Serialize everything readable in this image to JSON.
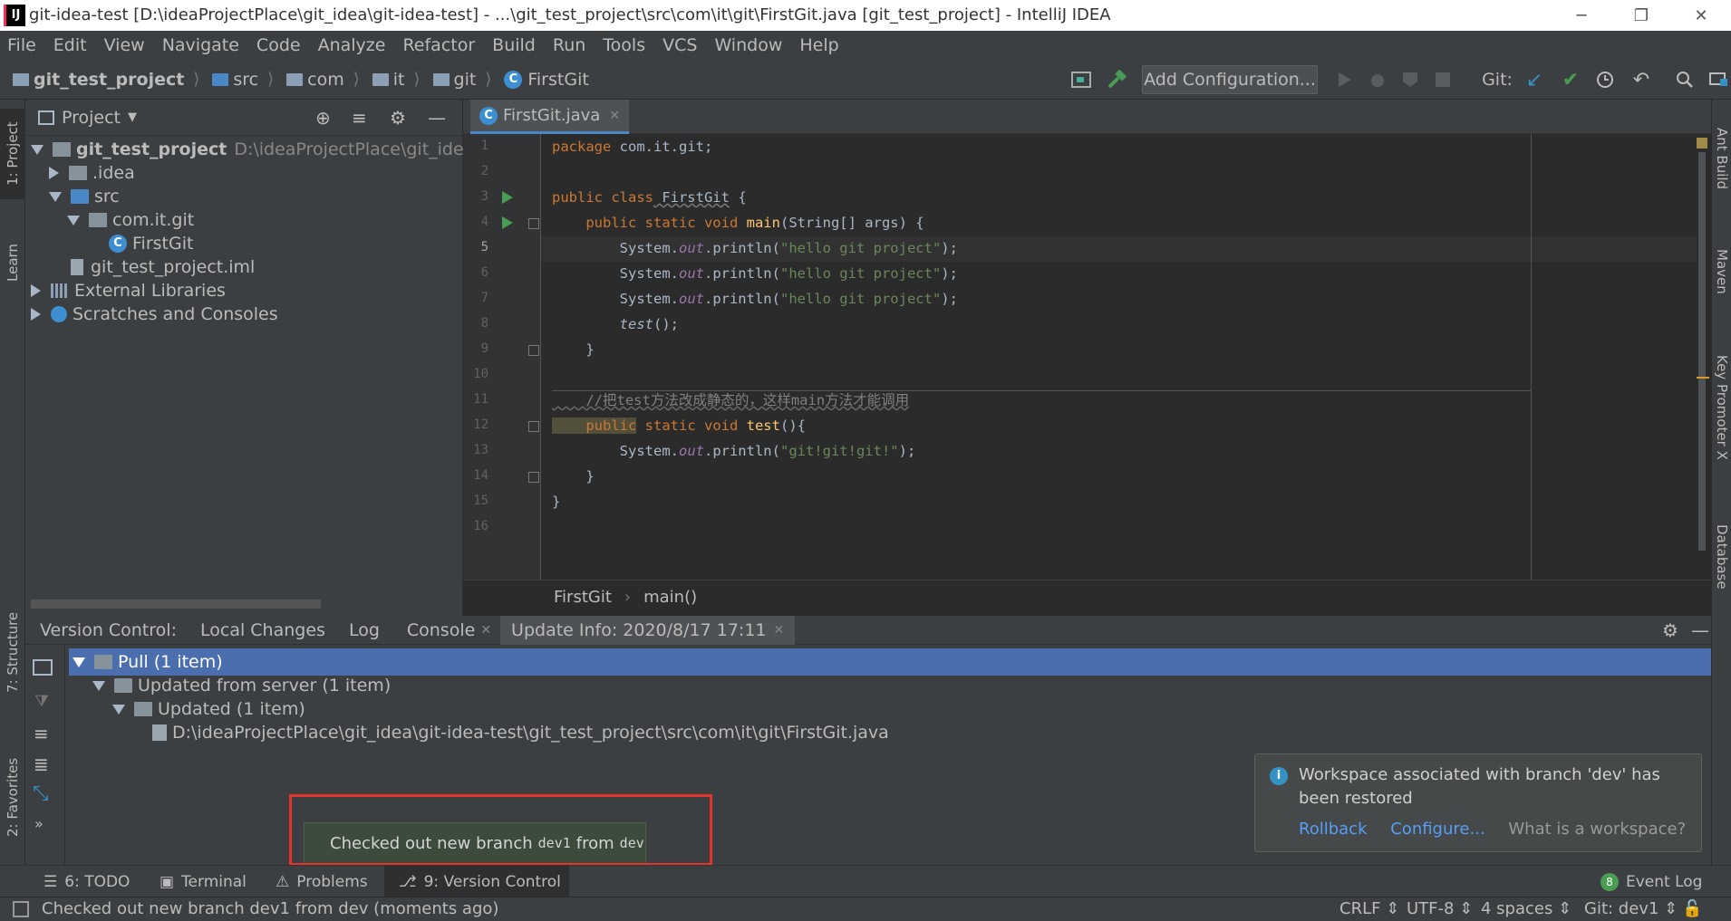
{
  "window": {
    "title": "git-idea-test [D:\\ideaProjectPlace\\git_idea\\git-idea-test] - ...\\git_test_project\\src\\com\\it\\git\\FirstGit.java [git_test_project] - IntelliJ IDEA",
    "app_icon": "IJ"
  },
  "menu": [
    "File",
    "Edit",
    "View",
    "Navigate",
    "Code",
    "Analyze",
    "Refactor",
    "Build",
    "Run",
    "Tools",
    "VCS",
    "Window",
    "Help"
  ],
  "breadcrumbs": [
    "git_test_project",
    "src",
    "com",
    "it",
    "git",
    "FirstGit"
  ],
  "toolbar": {
    "add_configuration": "Add Configuration...",
    "git_label": "Git:"
  },
  "left_stripe": {
    "project": "1: Project",
    "learn": "Learn",
    "structure": "7: Structure",
    "favorites": "2: Favorites"
  },
  "right_stripe": {
    "ant": "Ant Build",
    "maven": "Maven",
    "keypromoter": "Key Promoter X",
    "database": "Database"
  },
  "project_panel": {
    "title": "Project",
    "tree": [
      {
        "label": "git_test_project",
        "extra": "D:\\ideaProjectPlace\\git_idea\\git"
      },
      {
        "label": ".idea"
      },
      {
        "label": "src"
      },
      {
        "label": "com.it.git"
      },
      {
        "label": "FirstGit"
      },
      {
        "label": "git_test_project.iml"
      },
      {
        "label": "External Libraries"
      },
      {
        "label": "Scratches and Consoles"
      }
    ]
  },
  "editor": {
    "tab": "FirstGit.java",
    "line_numbers": [
      "1",
      "2",
      "3",
      "4",
      "5",
      "6",
      "7",
      "8",
      "9",
      "10",
      "11",
      "12",
      "13",
      "14",
      "15",
      "16"
    ],
    "lines": {
      "l1a": "package",
      "l1b": " com.it.git;",
      "l3a": "public class",
      "l3b": " FirstGit",
      "l3c": " {",
      "l4a": "    public static void",
      "l4b": " main",
      "l4c": "(String[] args) {",
      "p_sys": "        System.",
      "p_out": "out",
      "p_println": ".println(",
      "p_str": "\"hello git project\"",
      "p_end": ");",
      "l8a": "        test",
      "l8b": "();",
      "l9": "    }",
      "l11": "    //把test方法改成静态的，这样main方法才能调用",
      "l12a": "    public",
      "l12b": " static void",
      "l12c": " test",
      "l12d": "(){",
      "l13str": "\"git!git!git!\"",
      "l14": "    }",
      "l15": "}"
    },
    "breadcrumb": {
      "class": "FirstGit",
      "method": "main()"
    }
  },
  "version_control": {
    "tabs": [
      "Version Control:",
      "Local Changes",
      "Log",
      "Console",
      "Update Info: 2020/8/17 17:11"
    ],
    "tree": [
      "Pull (1 item)",
      "Updated from server (1 item)",
      "Updated (1 item)",
      "D:\\ideaProjectPlace\\git_idea\\git-idea-test\\git_test_project\\src\\com\\it\\git\\FirstGit.java"
    ]
  },
  "toast": {
    "pre": "Checked out new branch",
    "branch": "dev1",
    "mid": "from",
    "src": "dev"
  },
  "notification": {
    "text": "Workspace associated with branch 'dev' has been restored",
    "rollback": "Rollback",
    "configure": "Configure...",
    "what": "What is a workspace?"
  },
  "bottom_tabs": {
    "todo": "6: TODO",
    "terminal": "Terminal",
    "problems": "Problems",
    "vc": "9: Version Control",
    "event_count": "8",
    "event_log": "Event Log"
  },
  "status": {
    "message": "Checked out new branch dev1 from dev (moments ago)",
    "crlf": "CRLF",
    "encoding": "UTF-8",
    "indent": "4 spaces",
    "git": "Git: dev1"
  }
}
